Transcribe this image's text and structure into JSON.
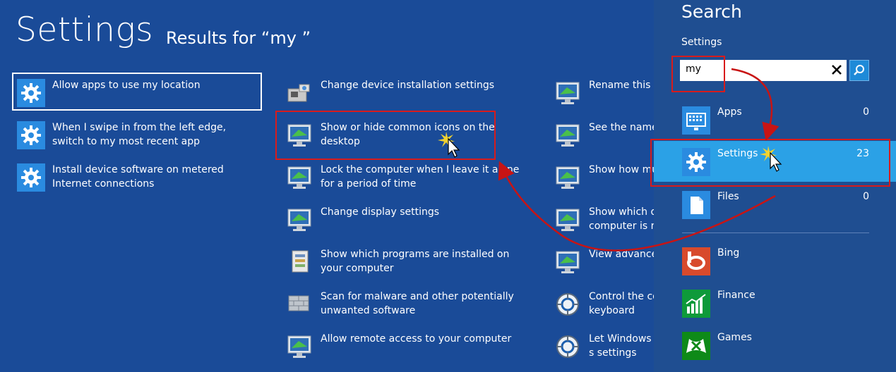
{
  "header": {
    "title": "Settings",
    "subtitle": "Results for “my ”"
  },
  "results": {
    "column1": [
      {
        "label": "Allow apps to use my location",
        "icon": "gear-icon",
        "selected": true
      },
      {
        "label": "When I swipe in from the left edge, switch to my most recent app",
        "icon": "gear-icon"
      },
      {
        "label": "Install device software on metered Internet connections",
        "icon": "gear-icon"
      }
    ],
    "column2": [
      {
        "label": "Change device installation settings",
        "icon": "device-install-icon"
      },
      {
        "label": "Show or hide common icons on the desktop",
        "icon": "monitor-icon"
      },
      {
        "label": "Lock the computer when I leave it alone for a period of time",
        "icon": "monitor-icon"
      },
      {
        "label": "Change display settings",
        "icon": "monitor-icon"
      },
      {
        "label": "Show which programs are installed on your computer",
        "icon": "programs-icon"
      },
      {
        "label": "Scan for malware and other potentially unwanted software",
        "icon": "wall-icon"
      },
      {
        "label": "Allow remote access to your computer",
        "icon": "monitor-icon"
      }
    ],
    "column3": [
      {
        "label": "Rename this c",
        "icon": "monitor-icon"
      },
      {
        "label": "See the name",
        "icon": "monitor-icon"
      },
      {
        "label": "Show how mu",
        "icon": "monitor-icon"
      },
      {
        "label": "Show which o computer is ru",
        "icon": "monitor-icon"
      },
      {
        "label": "View advance",
        "icon": "monitor-icon"
      },
      {
        "label": "Control the co keyboard",
        "icon": "ease-of-access-icon"
      },
      {
        "label": "Let Windows s settings",
        "icon": "ease-of-access-icon"
      }
    ]
  },
  "search": {
    "title": "Search",
    "scope_label": "Settings",
    "query": "my",
    "scopes": [
      {
        "label": "Apps",
        "count": "0",
        "icon": "apps-icon"
      },
      {
        "label": "Settings",
        "count": "23",
        "icon": "gear-icon",
        "active": true
      },
      {
        "label": "Files",
        "count": "0",
        "icon": "file-icon"
      }
    ],
    "apps": [
      {
        "label": "Bing",
        "icon": "bing-icon",
        "color": "#d84a2c"
      },
      {
        "label": "Finance",
        "icon": "finance-icon",
        "color": "#0e9a3a"
      },
      {
        "label": "Games",
        "icon": "games-icon",
        "color": "#0e8a18"
      }
    ]
  },
  "colors": {
    "background": "#1a4b98",
    "accent": "#2ba1e6",
    "highlight": "#d81b1b"
  }
}
